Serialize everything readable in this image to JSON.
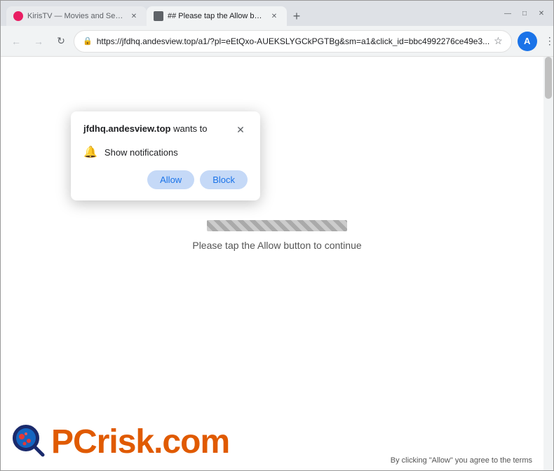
{
  "browser": {
    "tabs": [
      {
        "id": "tab1",
        "title": "KirisTV — Movies and Series D...",
        "favicon": "tv",
        "active": false
      },
      {
        "id": "tab2",
        "title": "## Please tap the Allow button...",
        "favicon": "page",
        "active": true
      }
    ],
    "new_tab_label": "+",
    "window_controls": {
      "minimize": "—",
      "maximize": "□",
      "close": "✕"
    },
    "address_bar": {
      "url": "https://jfdhq.andesview.top/a1/?pl=eEtQxo-AUEKSLYGCkPGTBg&sm=a1&click_id=bbc4992276ce49e3...",
      "lock_icon": "🔒"
    }
  },
  "permission_popup": {
    "site": "jfdhq.andesview.top",
    "wants_to_text": "wants to",
    "option_text": "Show notifications",
    "allow_label": "Allow",
    "block_label": "Block",
    "close_label": "✕"
  },
  "page": {
    "loading_text": "Please tap the Allow button to continue"
  },
  "watermark": {
    "pc_text": "PC",
    "risk_text": "risk.com"
  },
  "bottom_notice": {
    "text": "By clicking \"Allow\" you agree to the terms"
  }
}
